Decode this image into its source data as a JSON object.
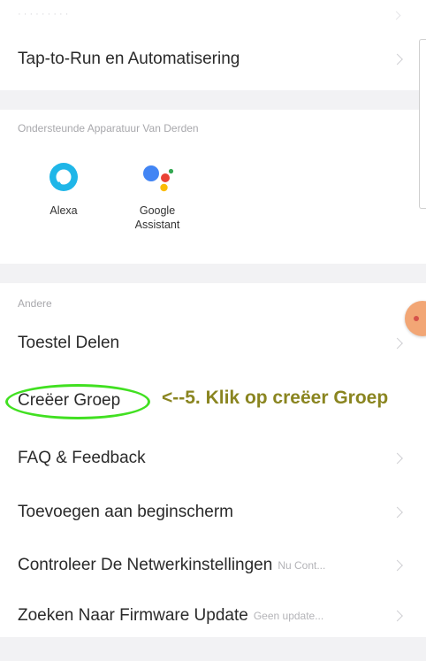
{
  "top": {
    "faded_label": "· · · · · · · · ·"
  },
  "menu_top": {
    "tap_to_run": "Tap-to-Run en Automatisering"
  },
  "third_party": {
    "header": "Ondersteunde Apparatuur Van Derden",
    "items": [
      {
        "label": "Alexa",
        "icon": "alexa-icon"
      },
      {
        "label": "Google\nAssistant",
        "icon": "google-assistant-icon"
      }
    ]
  },
  "other": {
    "header": "Andere",
    "items": [
      {
        "label": "Toestel Delen",
        "sub": ""
      },
      {
        "label": "Creëer Groep",
        "sub": ""
      },
      {
        "label": "FAQ & Feedback",
        "sub": ""
      },
      {
        "label": "Toevoegen aan beginscherm",
        "sub": ""
      },
      {
        "label": "Controleer De Netwerkinstellingen",
        "sub": "Nu Cont..."
      },
      {
        "label": "Zoeken Naar Firmware Update",
        "sub": "Geen update..."
      }
    ]
  },
  "annotation": {
    "text": "<--5. Klik op creëer Groep"
  },
  "colors": {
    "annotation": "#8a8520",
    "highlight": "#41e021",
    "alexa": "#1fb6e8",
    "google_blue": "#4285f4",
    "google_red": "#ea4335",
    "google_yellow": "#fbbc05",
    "google_green": "#34a853",
    "fab": "#f2a675"
  }
}
